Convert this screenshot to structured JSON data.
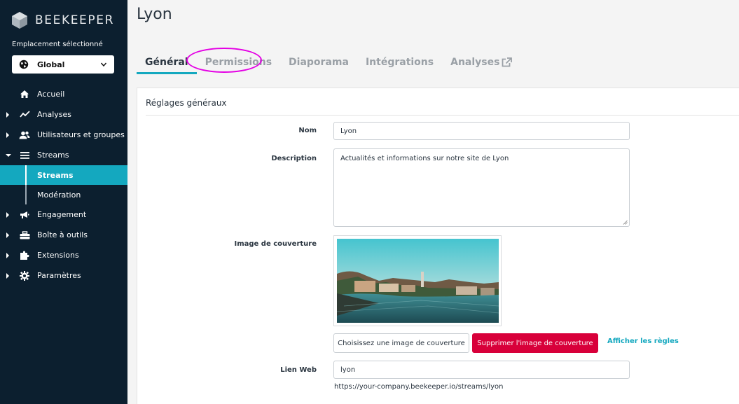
{
  "app": {
    "brand": "BEEKEEPER"
  },
  "sidebar": {
    "location_label": "Emplacement sélectionné",
    "location_value": "Global",
    "items": [
      {
        "label": "Accueil"
      },
      {
        "label": "Analyses"
      },
      {
        "label": "Utilisateurs et groupes"
      },
      {
        "label": "Streams"
      },
      {
        "label": "Streams"
      },
      {
        "label": "Modération"
      },
      {
        "label": "Engagement"
      },
      {
        "label": "Boîte à outils"
      },
      {
        "label": "Extensions"
      },
      {
        "label": "Paramètres"
      }
    ]
  },
  "page": {
    "title": "Lyon"
  },
  "tabs": [
    {
      "label": "Général"
    },
    {
      "label": "Permissions"
    },
    {
      "label": "Diaporama"
    },
    {
      "label": "Intégrations"
    },
    {
      "label": "Analyses"
    }
  ],
  "form": {
    "section_title": "Réglages généraux",
    "name_label": "Nom",
    "name_value": "Lyon",
    "description_label": "Description",
    "description_value": "Actualités et informations sur notre site de Lyon",
    "cover_label": "Image de couverture",
    "choose_button": "Choisissez une image de couverture",
    "delete_button": "Supprimer l'image de couverture",
    "rules_link": "Afficher les règles",
    "web_link_label": "Lien Web",
    "web_link_value": "lyon",
    "web_link_hint": "https://your-company.beekeeper.io/streams/lyon"
  },
  "colors": {
    "sidebar_bg": "#0c1f2f",
    "accent": "#14a8bf",
    "danger": "#d8003a",
    "highlight": "#e400e4"
  }
}
